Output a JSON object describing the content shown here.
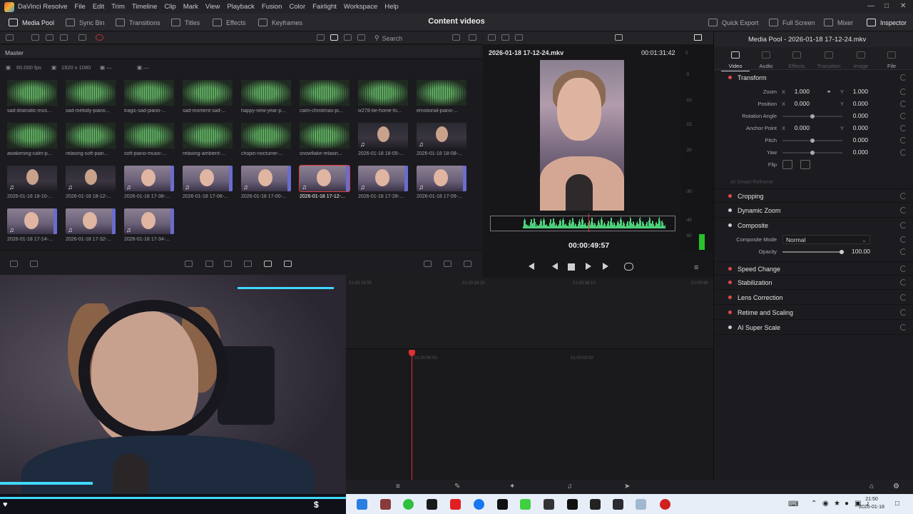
{
  "app": {
    "menu": [
      "DaVinci Resolve",
      "File",
      "Edit",
      "Trim",
      "Timeline",
      "Clip",
      "Mark",
      "View",
      "Playback",
      "Fusion",
      "Color",
      "Fairlight",
      "Workspace",
      "Help"
    ]
  },
  "toolbar": {
    "media_pool": "Media Pool",
    "sync_bin": "Sync Bin",
    "transitions": "Transitions",
    "titles": "Titles",
    "effects": "Effects",
    "keyframes": "Keyframes",
    "project_title": "Content videos",
    "quick_export": "Quick Export",
    "full_screen": "Full Screen",
    "mixer": "Mixer",
    "inspector": "Inspector"
  },
  "media_pool": {
    "search_placeholder": "Search",
    "bin": "Master",
    "fps": "60.000 fps",
    "resolution": "1920 x 1080",
    "clips": [
      {
        "name": "sad-dramatic-mus...",
        "kind": "audio"
      },
      {
        "name": "sad-melody-piano...",
        "kind": "audio"
      },
      {
        "name": "tragic-sad-piano-...",
        "kind": "audio"
      },
      {
        "name": "sad-moment-sad-...",
        "kind": "audio"
      },
      {
        "name": "happy-new-year-p...",
        "kind": "audio"
      },
      {
        "name": "calm-christmas-pi...",
        "kind": "audio"
      },
      {
        "name": "ix278-be-home-fo...",
        "kind": "audio"
      },
      {
        "name": "emotional-piano-...",
        "kind": "audio"
      },
      {
        "name": "awakening-calm-p...",
        "kind": "audio"
      },
      {
        "name": "relaxing-soft-pian...",
        "kind": "audio"
      },
      {
        "name": "soft-piano-music-...",
        "kind": "audio"
      },
      {
        "name": "relaxing-ambient-...",
        "kind": "audio"
      },
      {
        "name": "chopin-nocturne-...",
        "kind": "audio"
      },
      {
        "name": "snowflake-relaxin...",
        "kind": "audio"
      },
      {
        "name": "2026-01-18 18-05-...",
        "kind": "video"
      },
      {
        "name": "2026-01-18 18-08-...",
        "kind": "video"
      },
      {
        "name": "2026-01-18 18-10-...",
        "kind": "video"
      },
      {
        "name": "2026-01-18 18-12-...",
        "kind": "video"
      },
      {
        "name": "2026-01-18 17-38-...",
        "kind": "light"
      },
      {
        "name": "2026-01-18 17-06-...",
        "kind": "light"
      },
      {
        "name": "2026-01-18 17-00-...",
        "kind": "light"
      },
      {
        "name": "2026-01-18 17-12-...",
        "kind": "light",
        "selected": true
      },
      {
        "name": "2026-01-18 17-28-...",
        "kind": "light"
      },
      {
        "name": "2026-01-18 17-09-...",
        "kind": "light"
      },
      {
        "name": "2026-01-18 17-14-...",
        "kind": "light"
      },
      {
        "name": "2026-01-18 17-32-...",
        "kind": "light"
      },
      {
        "name": "2026-01-18 17-34-...",
        "kind": "light"
      }
    ]
  },
  "viewer": {
    "clip_name": "2026-01-18 17-12-24.mkv",
    "duration": "00:01:31:42",
    "current_time": "00:00:49:57",
    "meter_labels": [
      "0",
      "-5",
      "-10",
      "-15",
      "-20",
      "-30",
      "-40",
      "-50"
    ]
  },
  "inspector": {
    "title": "Media Pool - 2026-01-18 17-12-24.mkv",
    "tabs": [
      "Video",
      "Audio",
      "Effects",
      "Transition",
      "Image",
      "File"
    ],
    "transform": {
      "title": "Transform",
      "zoom_label": "Zoom",
      "zoom_x": "1.000",
      "zoom_y": "1.000",
      "position_label": "Position",
      "position_x": "0.000",
      "position_y": "0.000",
      "rotation_label": "Rotation Angle",
      "rotation": "0.000",
      "anchor_label": "Anchor Point",
      "anchor_x": "0.000",
      "anchor_y": "0.000",
      "pitch_label": "Pitch",
      "pitch": "0.000",
      "yaw_label": "Yaw",
      "yaw": "0.000",
      "flip_label": "Flip",
      "ai_reframe": "AI Smart Reframe"
    },
    "cropping": "Cropping",
    "dynamic_zoom": "Dynamic Zoom",
    "composite": {
      "title": "Composite",
      "mode_label": "Composite Mode",
      "mode_value": "Normal",
      "opacity_label": "Opacity",
      "opacity_value": "100.00"
    },
    "speed_change": "Speed Change",
    "stabilization": "Stabilization",
    "lens_correction": "Lens Correction",
    "retime_scaling": "Retime and Scaling",
    "ai_super_scale": "AI Super Scale"
  },
  "timeline": {
    "upper_ticks": [
      "01:00:19:05",
      "01:00:28:20",
      "01:00:38:10",
      "01:00:48"
    ],
    "lower_ticks": [
      "01:00:00:00",
      "01:00:02:00"
    ]
  },
  "taskbar": {
    "time": "21:50",
    "date": "2026-01-18"
  },
  "colors": {
    "accent_red": "#e03c3c",
    "wave_green": "#4dd07a",
    "meter_green": "#2ac02a"
  }
}
